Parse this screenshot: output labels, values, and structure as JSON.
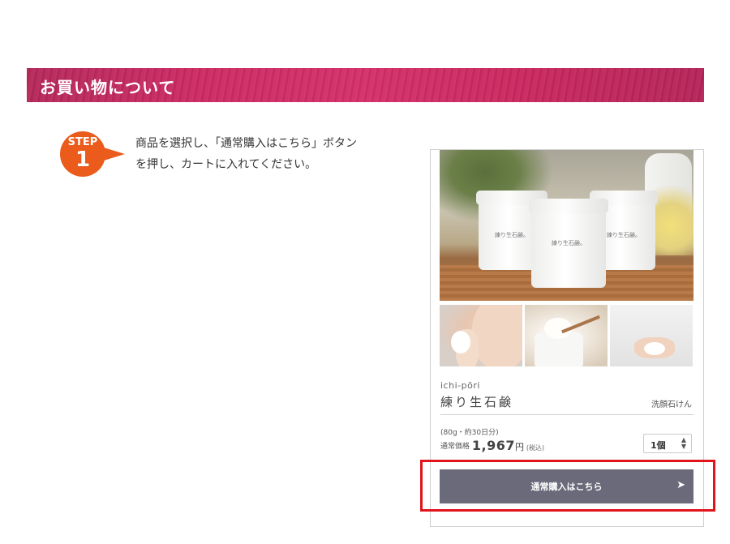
{
  "section": {
    "title": "お買い物について"
  },
  "step": {
    "word": "STEP",
    "number": "1",
    "line1": "商品を選択し、「通常購入はこちら」ボタン",
    "line2": "を押し、カートに入れてください。"
  },
  "product": {
    "jar_label": "練り生石鹸。",
    "brand_en": "ichi-pōri",
    "brand_jp": "練り生石鹸",
    "category": "洗顔石けん",
    "quantity_note": "(80g・約30日分)",
    "price_label": "通常価格",
    "price": "1,967",
    "currency": "円",
    "tax_note": "(税込)",
    "quantity_selected": "1個"
  },
  "cart": {
    "button_label": "通常購入はこちら",
    "button_icon": "chevron-right-icon"
  },
  "colors": {
    "banner": "#c82a60",
    "step_badge": "#ea5b1c",
    "button": "#6b6a7a",
    "highlight": "#e1141c"
  }
}
